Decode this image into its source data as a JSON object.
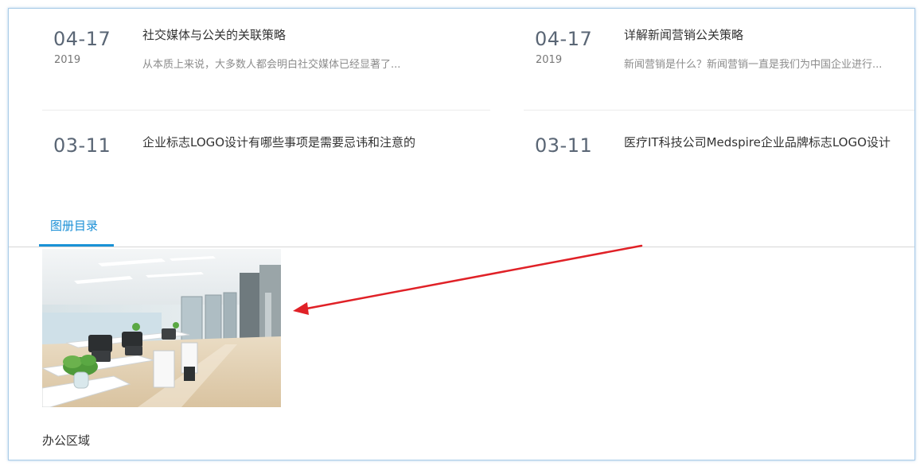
{
  "news": [
    {
      "day": "04-17",
      "year": "2019",
      "title": "社交媒体与公关的关联策略",
      "summary": "从本质上来说，大多数人都会明白社交媒体已经显著了..."
    },
    {
      "day": "04-17",
      "year": "2019",
      "title": "详解新闻营销公关策略",
      "summary": "新闻营销是什么？新闻营销一直是我们为中国企业进行..."
    },
    {
      "day": "03-11",
      "title": "企业标志LOGO设计有哪些事项是需要忌讳和注意的"
    },
    {
      "day": "03-11",
      "title": "医疗IT科技公司Medspire企业品牌标志LOGO设计"
    }
  ],
  "album": {
    "tab_label": "图册目录",
    "items": [
      {
        "caption": "办公区域",
        "image": "office-photo"
      }
    ]
  },
  "colors": {
    "accent": "#1a92d6",
    "annotation_arrow": "#e02127",
    "frame_border": "#a9cce8"
  }
}
